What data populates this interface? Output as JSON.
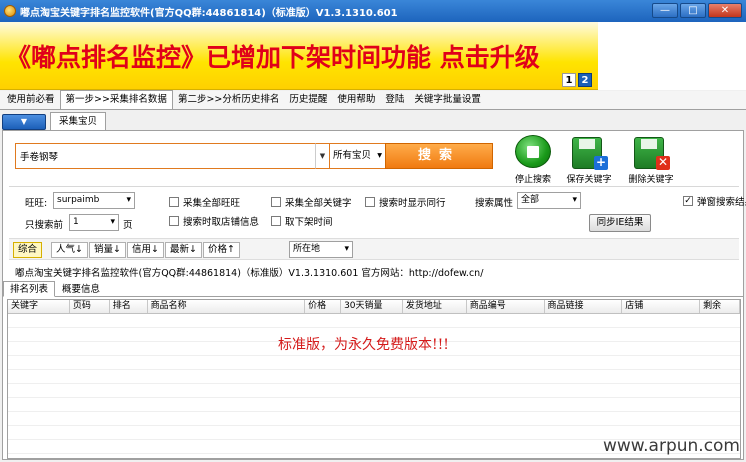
{
  "window": {
    "title": "嘟点淘宝关键字排名监控软件(官方QQ群:44861814)（标准版）V1.3.1310.601",
    "minimize_label": "—",
    "maximize_label": "□",
    "close_label": "✕"
  },
  "banner": {
    "text": "《嘟点排名监控》已增加下架时间功能  点击升级",
    "pages": [
      "1",
      "2"
    ],
    "active_page": "2"
  },
  "menu": {
    "items": [
      "使用前必看",
      "第一步>>采集排名数据",
      "第二步>>分析历史排名",
      "历史提醒",
      "使用帮助",
      "登陆",
      "关键字批量设置"
    ],
    "active": "第一步>>采集排名数据"
  },
  "subtabs": {
    "dropdown_symbol": "▼",
    "active_tab": "采集宝贝"
  },
  "search": {
    "keyword_value": "手卷钢琴",
    "scope_value": "所有宝贝",
    "button_label": "搜索"
  },
  "tools": {
    "stop_label": "停止搜索",
    "save_label": "保存关键字",
    "delete_label": "删除关键字"
  },
  "options": {
    "wangwang_label": "旺旺:",
    "wangwang_value": "surpaimb",
    "search_before_label": "只搜索前",
    "search_before_value": "1",
    "page_unit": "页",
    "collect_all_wangwang": "采集全部旺旺",
    "collect_all_keywords": "采集全部关键字",
    "show_peers": "搜索时显示同行",
    "fetch_store_info": "搜索时取店铺信息",
    "fetch_delist_time": "取下架时间",
    "search_attr_label": "搜索属性",
    "search_attr_value": "全部",
    "sync_ie_button": "同步IE结果",
    "popup_search": "弹窗搜索结果",
    "popup_checked": true
  },
  "sort": {
    "items": [
      "综合",
      "人气↓",
      "销量↓",
      "信用↓",
      "最新↓",
      "价格↑"
    ],
    "active": "综合",
    "location_value": "所在地"
  },
  "status": {
    "line": "嘟点淘宝关键字排名监控软件(官方QQ群:44861814)（标准版）V1.3.1310.601  官方网站：http://dofew.cn/"
  },
  "result_tabs": {
    "items": [
      "排名列表",
      "概要信息"
    ],
    "active": "排名列表"
  },
  "grid": {
    "columns": [
      "关键字",
      "页码",
      "排名",
      "商品名称",
      "价格",
      "30天销量",
      "发货地址",
      "商品编号",
      "商品链接",
      "店铺",
      "剩余"
    ],
    "note": "标准版，为永久免费版本!!!"
  },
  "watermark": "www.arpun.com",
  "colors": {
    "banner_text": "#e0001a",
    "search_button": "#f07a10",
    "accent_blue": "#1c5fb8",
    "note_red": "#d41a1a"
  }
}
